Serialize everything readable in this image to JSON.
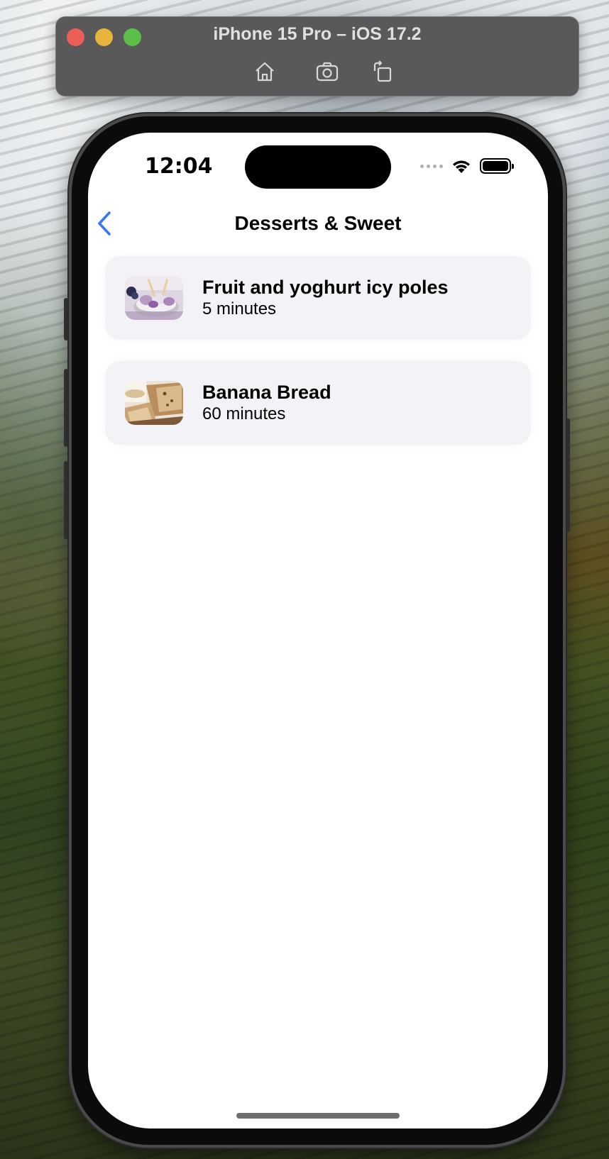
{
  "simulator": {
    "title": "iPhone 15 Pro – iOS 17.2",
    "toolbar": [
      "home-icon",
      "screenshot-icon",
      "rotate-icon"
    ]
  },
  "status_bar": {
    "time": "12:04",
    "icons": [
      "cellular-dots-icon",
      "wifi-icon",
      "battery-icon"
    ]
  },
  "nav": {
    "title": "Desserts & Sweet",
    "back_icon": "chevron-left-icon",
    "accent": "#3478f6"
  },
  "recipes": [
    {
      "name": "Fruit and yoghurt icy poles",
      "duration": "5 minutes",
      "thumbnail": "icy-poles-image"
    },
    {
      "name": "Banana Bread",
      "duration": "60 minutes",
      "thumbnail": "banana-bread-image"
    }
  ],
  "colors": {
    "card_bg": "#f2f2f7",
    "screen_bg": "#ffffff",
    "simulator_bar": "#595959"
  }
}
